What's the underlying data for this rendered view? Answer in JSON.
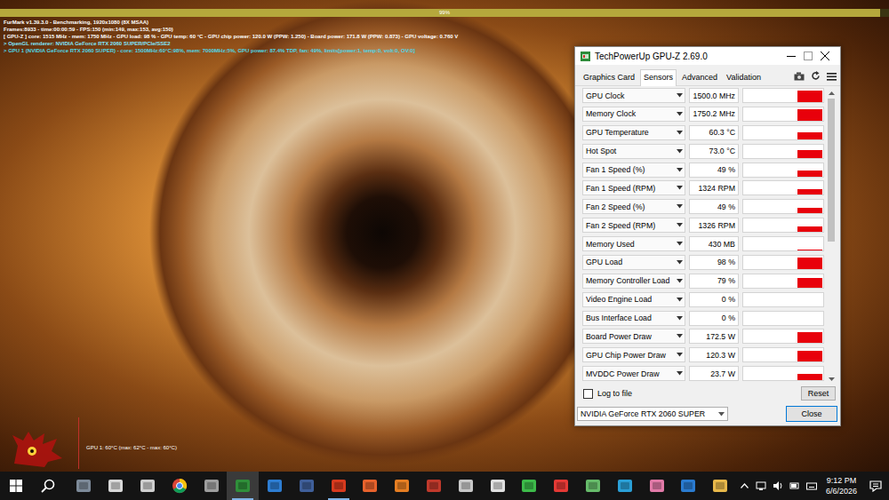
{
  "furmark": {
    "progress": {
      "label": "99%",
      "level": 0.99
    },
    "osd": [
      {
        "text": "FurMark v1.39.3.0 - Benchmarking, 1920x1080 (8X MSAA)",
        "color": "#ffffff"
      },
      {
        "text": "Frames:8933 - time:00:00:59 - FPS:150 (min:149, max:153, avg:150)",
        "color": "#ffffff"
      },
      {
        "text": "[ GPU-Z ] core: 1515 MHz - mem: 1750 MHz - GPU load: 98 % - GPU temp: 60 °C - GPU chip power: 120.0 W (PPW: 1.250) - Board power: 171.8 W (PPW: 0.873) - GPU voltage: 0.760 V",
        "color": "#ffffff"
      },
      {
        "text": "> OpenGL renderer: NVIDIA GeForce RTX 2060 SUPER/PCIe/SSE2",
        "color": "#7fe8ff"
      },
      {
        "text": "> GPU 1 (NVIDIA GeForce RTX 2060 SUPER) - core: 1500MHz:60°C:98%, mem: 7000MHz:5%, GPU power: 87.4% TDP, fan: 49%, limits[power:1, temp:0, volt:0, OV:0]",
        "color": "#4fd8e8"
      }
    ],
    "temp_graph": {
      "label": "GPU 1: 60°C (max: 62°C - max: 60°C)"
    }
  },
  "gpuz": {
    "window": {
      "title": "TechPowerUp GPU-Z 2.69.0"
    },
    "tabs": [
      {
        "label": "Graphics Card",
        "selected": false
      },
      {
        "label": "Sensors",
        "selected": true
      },
      {
        "label": "Advanced",
        "selected": false
      },
      {
        "label": "Validation",
        "selected": false
      }
    ],
    "sensors": [
      {
        "label": "GPU Clock",
        "value": "1500.0 MHz",
        "level": 0.85
      },
      {
        "label": "Memory Clock",
        "value": "1750.2 MHz",
        "level": 0.85
      },
      {
        "label": "GPU Temperature",
        "value": "60.3 °C",
        "level": 0.5
      },
      {
        "label": "Hot Spot",
        "value": "73.0 °C",
        "level": 0.55
      },
      {
        "label": "Fan 1 Speed (%)",
        "value": "49 %",
        "level": 0.45
      },
      {
        "label": "Fan 1 Speed (RPM)",
        "value": "1324 RPM",
        "level": 0.4
      },
      {
        "label": "Fan 2 Speed (%)",
        "value": "49 %",
        "level": 0.45
      },
      {
        "label": "Fan 2 Speed (RPM)",
        "value": "1326 RPM",
        "level": 0.4
      },
      {
        "label": "Memory Used",
        "value": "430 MB",
        "level": 0.05
      },
      {
        "label": "GPU Load",
        "value": "98 %",
        "level": 0.85
      },
      {
        "label": "Memory Controller Load",
        "value": "79 %",
        "level": 0.75
      },
      {
        "label": "Video Engine Load",
        "value": "0 %",
        "level": 0
      },
      {
        "label": "Bus Interface Load",
        "value": "0 %",
        "level": 0
      },
      {
        "label": "Board Power Draw",
        "value": "172.5 W",
        "level": 0.8
      },
      {
        "label": "GPU Chip Power Draw",
        "value": "120.3 W",
        "level": 0.8
      },
      {
        "label": "MVDDC Power Draw",
        "value": "23.7 W",
        "level": 0.45
      }
    ],
    "scrollbar": {
      "position": 0,
      "visible_share": 0.52
    },
    "log_to_file": {
      "label": "Log to file",
      "checked": false
    },
    "reset_button": "Reset",
    "device_select": {
      "value": "NVIDIA GeForce RTX 2060 SUPER"
    },
    "close_button": "Close"
  },
  "taskbar": {
    "apps": [
      {
        "running": false,
        "active": false
      },
      {
        "running": false,
        "active": false
      },
      {
        "running": false,
        "active": false
      },
      {
        "running": false,
        "active": false
      },
      {
        "running": false,
        "active": false
      },
      {
        "running": true,
        "active": true
      },
      {
        "running": false,
        "active": false
      },
      {
        "running": false,
        "active": false
      },
      {
        "running": true,
        "active": false
      },
      {
        "running": false,
        "active": false
      },
      {
        "running": false,
        "active": false
      },
      {
        "running": false,
        "active": false
      },
      {
        "running": false,
        "active": false
      },
      {
        "running": false,
        "active": false
      },
      {
        "running": false,
        "active": false
      },
      {
        "running": false,
        "active": false
      },
      {
        "running": false,
        "active": false
      },
      {
        "running": false,
        "active": false
      },
      {
        "running": false,
        "active": false
      },
      {
        "running": false,
        "active": false
      },
      {
        "running": false,
        "active": false
      }
    ],
    "clock": {
      "time": "9:12 PM",
      "date": "6/6/2026"
    }
  }
}
